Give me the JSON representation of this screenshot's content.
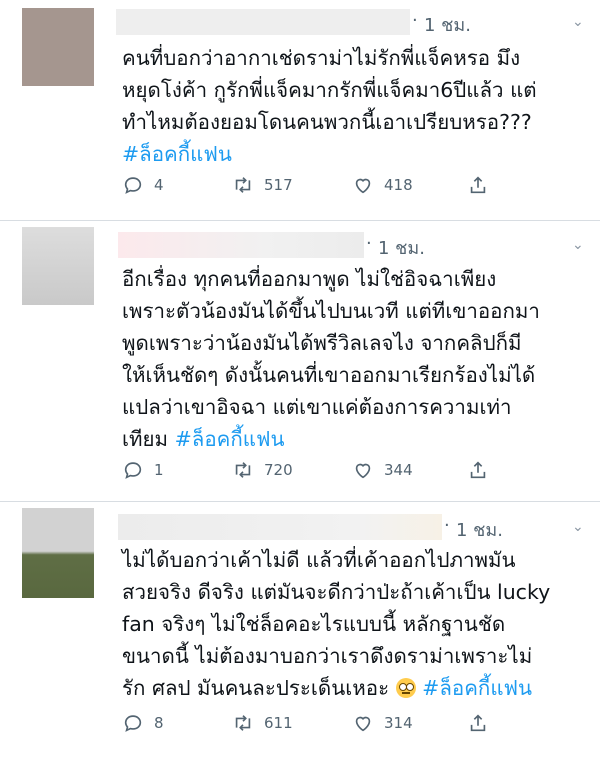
{
  "tweets": [
    {
      "time": "1 ชม.",
      "lines": [
        "คนที่บอกว่าอากาเช่ดราม่าไม่รักพี่แจ็คหรอ มึง",
        "หยุดโง่ค้า กูรักพี่แจ็คมากรักพี่แจ็คมา6ปีแล้ว แต่",
        "ทำไหมต้องยอมโดนคนพวกนี้เอาเปรียบหรอ???"
      ],
      "tag_line_prefix": "",
      "hashtag": "#ล็อคกี้แฟน",
      "replies": "4",
      "retweets": "517",
      "likes": "418"
    },
    {
      "time": "1 ชม.",
      "lines": [
        "อีกเรื่อง ทุกคนที่ออกมาพูด ไม่ใช่อิจฉาเพียง",
        "เพราะตัวน้องมันได้ขึ้นไปบนเวที แต่ทีเขาออกมา",
        "พูดเพราะว่าน้องมันได้พรีวิลเลจไง จากคลิปก็มี",
        "ให้เห็นชัดๆ ดังนั้นคนที่เขาออกมาเรียกร้องไม่ได้",
        "แปลว่าเขาอิจฉา แต่เขาแค่ต้องการความเท่า"
      ],
      "tag_line_prefix": "เทียม",
      "hashtag": "#ล็อคกี้แฟน",
      "replies": "1",
      "retweets": "720",
      "likes": "344"
    },
    {
      "time": "1 ชม.",
      "lines": [
        "ไม่ได้บอกว่าเค้าไม่ดี แล้วที่เค้าออกไปภาพมัน",
        "สวยจริง ดีจริง แต่มันจะดีกว่าป่ะถ้าเค้าเป็น lucky",
        "fan จริงๆ ไม่ใช่ล็อคอะไรแบบนี้ หลักฐานชัด",
        "ขนาดนี้ ไม่ต้องมาบอกว่าเราดึงดราม่าเพราะไม่"
      ],
      "tag_line_prefix": "รัก ศลป มันคนละประเด็นเหอะ",
      "hashtag": "#ล็อคกี้แฟน",
      "replies": "8",
      "retweets": "611",
      "likes": "314"
    }
  ],
  "icons": {
    "reply": "reply-icon",
    "retweet": "retweet-icon",
    "like": "heart-icon",
    "share": "share-icon",
    "more": "chevron-down-icon"
  },
  "colors": {
    "hashtag": "#1d9bf0",
    "muted": "#536471",
    "separator": "#d8dde2"
  }
}
